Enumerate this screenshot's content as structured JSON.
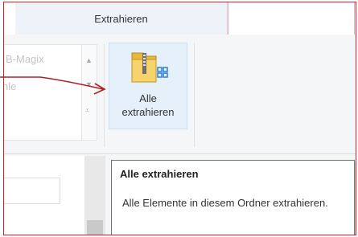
{
  "ribbon": {
    "tab_label": "Extrahieren",
    "gallery_items": [
      "B-Magix",
      "nle"
    ],
    "extract_button": {
      "label_line1": "Alle",
      "label_line2": "extrahieren",
      "icon": "zip-folder-extract-icon"
    }
  },
  "tooltip": {
    "title": "Alle extrahieren",
    "description": "Alle Elemente in diesem Ordner extrahieren."
  },
  "colors": {
    "frame_border": "#c4262e",
    "annotation_arrow": "#b01e28",
    "button_highlight": "#e5f0fb"
  }
}
